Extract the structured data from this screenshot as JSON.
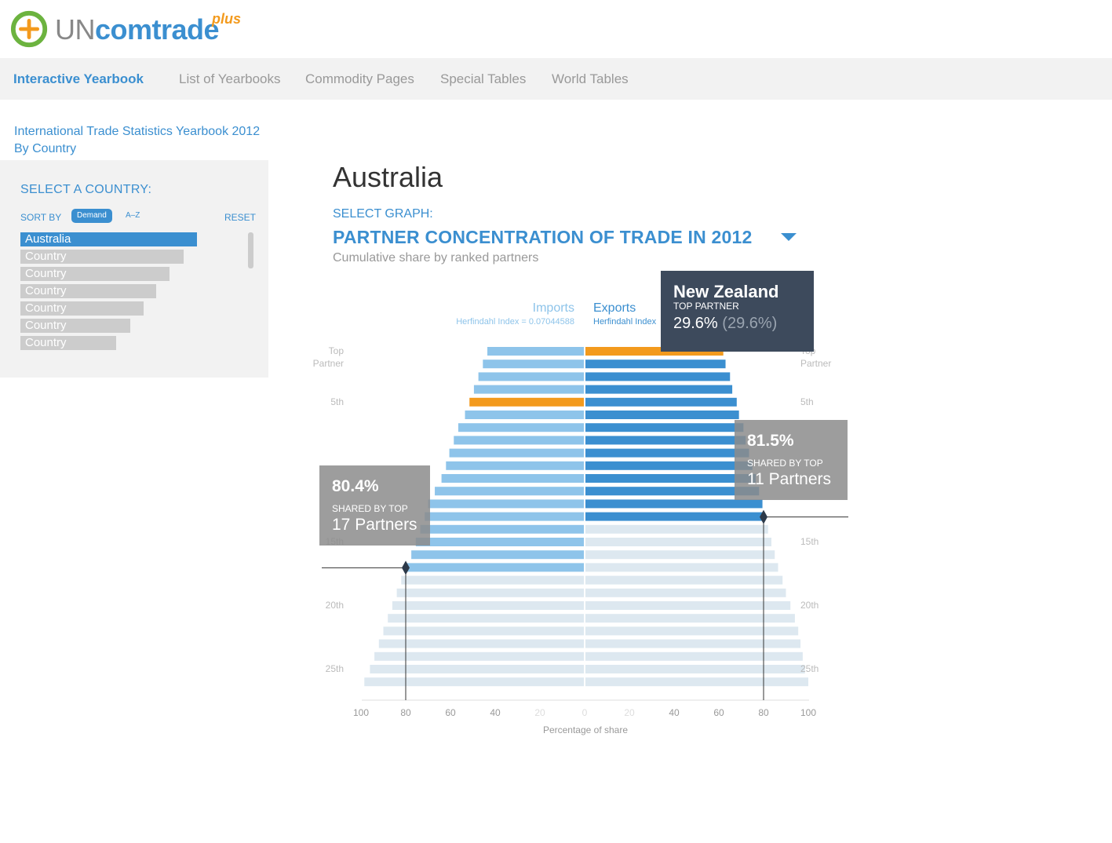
{
  "logo": {
    "un": "UN",
    "comtrade": "comtrade",
    "plus": "plus"
  },
  "nav": [
    {
      "label": "Interactive Yearbook",
      "active": true
    },
    {
      "label": "List of Yearbooks"
    },
    {
      "label": "Commodity Pages"
    },
    {
      "label": "Special Tables"
    },
    {
      "label": "World Tables"
    }
  ],
  "subtitle": {
    "line1": "International Trade Statistics Yearbook 2012",
    "line2": "By Country"
  },
  "sidebar": {
    "select_label": "SELECT A COUNTRY:",
    "sort_by": "SORT BY",
    "sort_demand": "Demand",
    "sort_az": "A–Z",
    "reset": "RESET",
    "countries": [
      "Australia",
      "Country",
      "Country",
      "Country",
      "Country",
      "Country",
      "Country"
    ]
  },
  "main": {
    "country": "Australia",
    "select_graph": "SELECT GRAPH:",
    "graph_title": "PARTNER CONCENTRATION OF TRADE IN 2012",
    "graph_subtitle": "Cumulative share by ranked partners"
  },
  "colors": {
    "accent": "#3b8fd0",
    "imports": "#8ec4ea",
    "exports": "#3b8fd0",
    "highlight": "#f39a1d",
    "faded": "#dde8f0"
  },
  "chart_data": {
    "type": "bar",
    "title": "",
    "series": [
      {
        "name": "Imports",
        "herfindahl": "Herfindahl Index = 0.07044588",
        "values": [
          43.5,
          45.5,
          47.5,
          49.5,
          51.5,
          53.5,
          56.5,
          58.5,
          60.5,
          62,
          64,
          67,
          70,
          71.5,
          73.5,
          75.5,
          77.5,
          80.4,
          82,
          84,
          86,
          88,
          90,
          92,
          94,
          96,
          98.5
        ],
        "highlighted_rank": 5
      },
      {
        "name": "Exports",
        "herfindahl": "Herfindahl Index",
        "values": [
          62,
          63,
          65,
          66,
          68,
          69,
          71,
          72,
          73.5,
          75,
          76.5,
          78,
          79.5,
          80.5,
          82,
          83.5,
          85,
          86.5,
          88.5,
          90,
          92,
          94,
          95.5,
          96.5,
          97.5,
          98.5,
          100
        ],
        "highlighted_rank": 1
      }
    ],
    "rank_labels": [
      "Top Partner",
      "5th",
      "15th",
      "20th",
      "25th"
    ],
    "xlabel": "Percentage of share",
    "x_ticks": [
      100,
      80,
      60,
      40,
      20,
      0,
      20,
      40,
      60,
      80,
      100
    ],
    "xlim": [
      0,
      100
    ],
    "annotations": {
      "top_partner": {
        "name": "New Zealand",
        "label": "TOP PARTNER",
        "value": "29.6%",
        "value2": "(29.6%)"
      },
      "exports_threshold": {
        "value": "81.5%",
        "label": "SHARED BY TOP",
        "partners": "11 Partners",
        "at": 80,
        "rank": 14
      },
      "imports_threshold": {
        "value": "80.4%",
        "label": "SHARED BY TOP",
        "partners": "17 Partners",
        "at": 80,
        "rank": 18
      }
    }
  }
}
